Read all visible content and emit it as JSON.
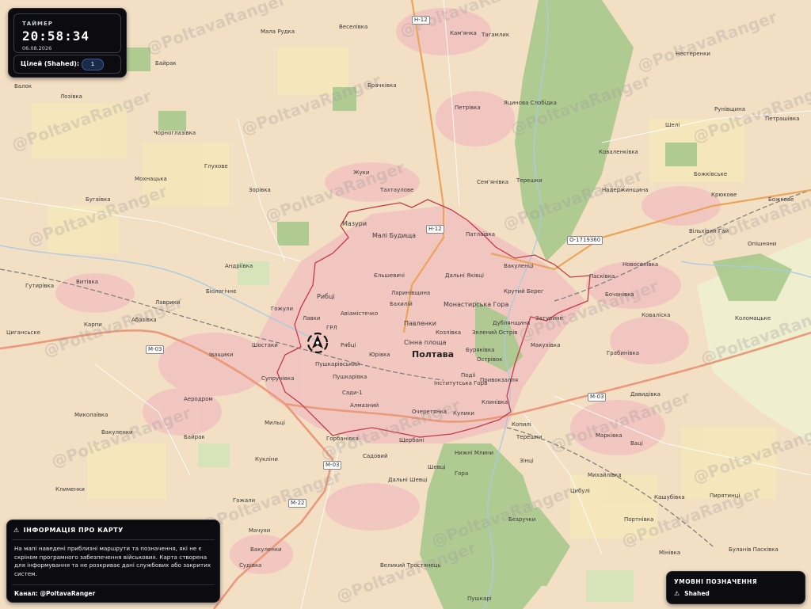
{
  "timer": {
    "label": "ТАЙМЕР",
    "time": "20:58:34",
    "date": "06.08.2026"
  },
  "targets": {
    "label": "Цілей (Shahed):",
    "count": "1"
  },
  "info": {
    "title": "ІНФОРМАЦІЯ ПРО КАРТУ",
    "body": "На мапі наведені приблизні маршрути та позначення, які не є скріном програмного забезпечення військових. Карта створена для інформування та не розкриває дані службових або закритих систем.",
    "channel": "Канал: @PoltavaRanger"
  },
  "legend": {
    "title": "УМОВНІ ПОЗНАЧЕННЯ",
    "items": [
      {
        "label": "Shahed",
        "icon": "warning-triangle-icon"
      }
    ]
  },
  "watermark": "@PoltavaRanger",
  "map": {
    "city": "Полтава",
    "places": [
      "Таймер",
      "Мала Рудка",
      "Веселівка",
      "Кам'янка",
      "Тагамлик",
      "Байрак",
      "Валок",
      "Лозівка",
      "Брачківка",
      "Петрівка",
      "Нестеренки",
      "Яцинова Слобідка",
      "Рунівщина",
      "Петрашівка",
      "Шелі",
      "Чорноглазівка",
      "Коваленківка",
      "Глухове",
      "Мохнацька",
      "Божківське",
      "Жуки",
      "Семʼянівка",
      "Терешки",
      "Надержинщина",
      "Зорівка",
      "Тахтаулове",
      "Бугаївка",
      "Крюкове",
      "Божкове",
      "Мазури",
      "Малі Будища",
      "Патлаївка",
      "Вільхівий Гай",
      "Опішняни",
      "Андріївка",
      "Вакуленці",
      "Новоселівка",
      "Пасківка",
      "Гутирівка",
      "Витівка",
      "Єльшевичі",
      "Дальні Яківці",
      "Ларинівщина",
      "Бочанівка",
      "Біологічне",
      "Рибці",
      "Крутий Берег",
      "Лаврики",
      "Гожули",
      "Абазівка",
      "Авіамістечко",
      "Бахилій",
      "Монастирська Гора",
      "Затурине",
      "Коваліска",
      "Коломацьке",
      "Цигансьске",
      "Карпи",
      "Лавки",
      "ГРЛ",
      "Павленки",
      "Дублянщина",
      "Козлівка",
      "Зелений Острів",
      "Макухівка",
      "Грабинівка",
      "Шостаки",
      "Рябці",
      "Сінна площа",
      "Буряківка",
      "Юрівка",
      "Пушкарівський",
      "Острівок",
      "Подіі",
      "Іващики",
      "Супрунівка",
      "Пушкарівка",
      "Привокзалля",
      "Інститутська Гора",
      "Аеродром",
      "Сади-1",
      "Клинівка",
      "Давидівка",
      "Миколаївка",
      "Мильці",
      "Алмазний",
      "Очеретянка",
      "Кулики",
      "Копилі",
      "Терешки",
      "Марківка",
      "Ваці",
      "Вакуленки",
      "Байрак",
      "Горбанівка",
      "Щербані",
      "Кукліни",
      "Садовий",
      "Нижні Млини",
      "Зінці",
      "Михайлівка",
      "Шевці",
      "Гора",
      "Дальні Шевці",
      "Клименки",
      "Цибулі",
      "Кашубівка",
      "Пирятинці",
      "Портнівка",
      "Гожали",
      "Мачухи",
      "Безручки",
      "Вакуленки",
      "Мінівка",
      "Судівка",
      "Великий Тростянець",
      "Буланів Пасківка",
      "Пушкарі"
    ],
    "roads": [
      "Н-12",
      "Н-12",
      "М-03",
      "М-03",
      "М-03",
      "М-22",
      "О-1719360"
    ]
  },
  "colors": {
    "panel_bg": "#0b0b10",
    "urban": "#f4c9c3",
    "field": "#f3dfc4",
    "forest": "#aacb8f",
    "boundary": "#c43a4a",
    "road_main": "#e99a7b",
    "road_trunk": "#e8a55c"
  }
}
